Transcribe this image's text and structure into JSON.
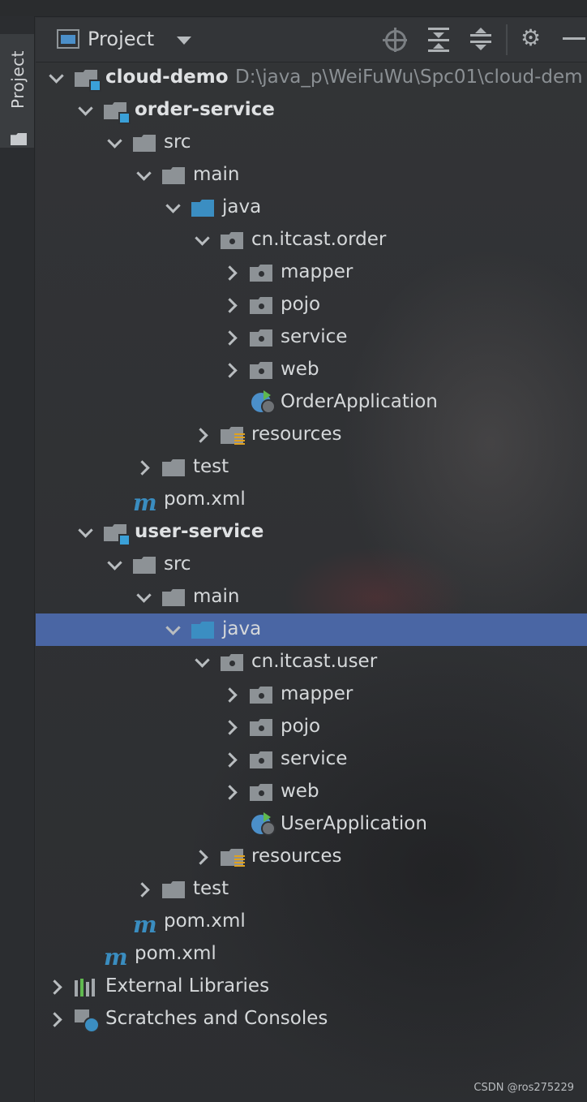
{
  "window": {
    "side_tab_label": "Project",
    "header_title": "Project",
    "toolbar": {
      "locate_icon": "crosshair-icon",
      "expand_icon": "expand-all-icon",
      "collapse_icon": "collapse-all-icon",
      "settings_icon": "gear-icon",
      "hide_icon": "minimize-icon"
    }
  },
  "tree": [
    {
      "label": "cloud-demo",
      "path": "D:\\java_p\\WeiFuWu\\Spc01\\cloud-dem",
      "type": "module",
      "bold": true,
      "expanded": true
    },
    {
      "label": "order-service",
      "type": "module",
      "bold": true,
      "expanded": true
    },
    {
      "label": "src",
      "type": "folder",
      "expanded": true
    },
    {
      "label": "main",
      "type": "folder",
      "expanded": true
    },
    {
      "label": "java",
      "type": "source-folder",
      "expanded": true
    },
    {
      "label": "cn.itcast.order",
      "type": "package",
      "expanded": true
    },
    {
      "label": "mapper",
      "type": "package",
      "expanded": false
    },
    {
      "label": "pojo",
      "type": "package",
      "expanded": false
    },
    {
      "label": "service",
      "type": "package",
      "expanded": false
    },
    {
      "label": "web",
      "type": "package",
      "expanded": false
    },
    {
      "label": "OrderApplication",
      "type": "spring-app"
    },
    {
      "label": "resources",
      "type": "resources",
      "expanded": false
    },
    {
      "label": "test",
      "type": "folder",
      "expanded": false
    },
    {
      "label": "pom.xml",
      "type": "maven"
    },
    {
      "label": "user-service",
      "type": "module",
      "bold": true,
      "expanded": true
    },
    {
      "label": "src",
      "type": "folder",
      "expanded": true
    },
    {
      "label": "main",
      "type": "folder",
      "expanded": true
    },
    {
      "label": "java",
      "type": "source-folder",
      "expanded": true,
      "selected": true
    },
    {
      "label": "cn.itcast.user",
      "type": "package",
      "expanded": true
    },
    {
      "label": "mapper",
      "type": "package",
      "expanded": false
    },
    {
      "label": "pojo",
      "type": "package",
      "expanded": false
    },
    {
      "label": "service",
      "type": "package",
      "expanded": false
    },
    {
      "label": "web",
      "type": "package",
      "expanded": false
    },
    {
      "label": "UserApplication",
      "type": "spring-app"
    },
    {
      "label": "resources",
      "type": "resources",
      "expanded": false
    },
    {
      "label": "test",
      "type": "folder",
      "expanded": false
    },
    {
      "label": "pom.xml",
      "type": "maven"
    },
    {
      "label": "pom.xml",
      "type": "maven"
    },
    {
      "label": "External Libraries",
      "type": "libraries",
      "expanded": false
    },
    {
      "label": "Scratches and Consoles",
      "type": "scratches",
      "expanded": false
    }
  ],
  "colors": {
    "selection": "#4a66a4",
    "module_accent": "#3aa0d8",
    "maven": "#3a8dc0",
    "resources_accent": "#e0a21f"
  },
  "watermark": "CSDN @ros275229"
}
